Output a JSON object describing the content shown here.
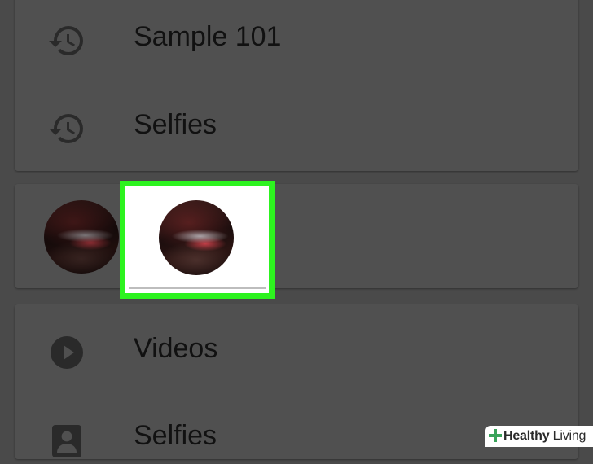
{
  "colors": {
    "background": "#4a4a4a",
    "card": "#505050",
    "text": "#111111",
    "icon": "#2a2a2a",
    "highlight": "#2df31f",
    "watermark_green": "#3aa35a",
    "watermark_text": "#2a2a2a"
  },
  "recent_searches": [
    {
      "label": "Sample 101",
      "icon": "history-icon"
    },
    {
      "label": "Selfies",
      "icon": "history-icon"
    }
  ],
  "people": {
    "faces": [
      {
        "name": "face-thumbnail",
        "highlighted": false
      },
      {
        "name": "face-thumbnail",
        "highlighted": true
      }
    ]
  },
  "albums": [
    {
      "label": "Videos",
      "icon": "play-circle-icon"
    },
    {
      "label": "Selfies",
      "icon": "person-portrait-icon"
    }
  ],
  "watermark": {
    "brand_bold": "Healthy",
    "brand_regular": " Living"
  }
}
